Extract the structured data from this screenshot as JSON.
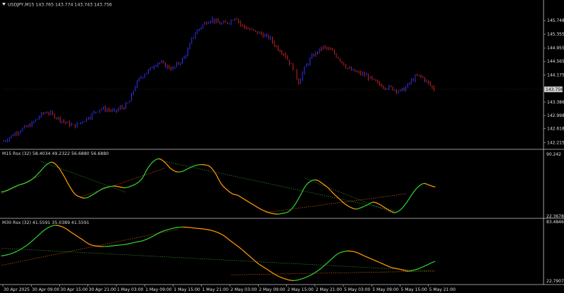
{
  "header": {
    "symbol_line": "USDJPY,M15  143.765 143.774 143.743 143.756",
    "menu_arrow": "triangle-down-icon"
  },
  "colors": {
    "background": "#000000",
    "bull_candle": "#3333ff",
    "bear_candle": "#cc2222",
    "current_price_box": "#d0d0d0",
    "rsi_up": "#33cc33",
    "rsi_down": "#ff9900",
    "trend_green": "#2f8f2f",
    "trend_orange": "#cc5a00",
    "separator": "#c8c8c8"
  },
  "chart_data": [
    {
      "type": "candlestick",
      "name": "USDJPY,M15",
      "ylim": [
        142.1,
        146.1
      ],
      "y_ticks": [
        "145.748",
        "145.355",
        "144.955",
        "144.565",
        "144.175",
        "143.756",
        "143.386",
        "142.998",
        "142.618",
        "142.215"
      ],
      "current_price": 143.756,
      "close_path": [
        142.25,
        142.35,
        142.45,
        142.55,
        142.62,
        142.68,
        142.78,
        142.92,
        143.05,
        143.1,
        143.02,
        142.95,
        142.85,
        142.78,
        142.72,
        142.7,
        142.82,
        142.9,
        143.0,
        143.12,
        143.2,
        143.18,
        143.15,
        143.1,
        143.22,
        143.25,
        143.4,
        143.8,
        144.05,
        144.2,
        144.3,
        144.45,
        144.55,
        144.48,
        144.4,
        144.35,
        144.5,
        144.62,
        144.85,
        145.25,
        145.45,
        145.6,
        145.72,
        145.8,
        145.7,
        145.65,
        145.68,
        145.75,
        145.88,
        145.62,
        145.55,
        145.48,
        145.42,
        145.38,
        145.3,
        145.25,
        145.05,
        144.9,
        144.8,
        144.55,
        144.35,
        143.95,
        144.3,
        144.55,
        144.75,
        144.85,
        144.98,
        144.92,
        144.85,
        144.7,
        144.55,
        144.38,
        144.3,
        144.25,
        144.2,
        144.15,
        144.05,
        143.95,
        143.88,
        143.82,
        143.8,
        143.75,
        143.7,
        143.78,
        143.95,
        144.1,
        144.15,
        144.05,
        143.9,
        143.756
      ]
    },
    {
      "type": "line",
      "name": "RSI M15",
      "label": "M15  Rsx (32) 58.4034 49.2322 56.6880 56.6880",
      "ylim": [
        22.3678,
        90.242
      ],
      "y_ticks": [
        "90.242",
        "22.3678"
      ],
      "values": [
        50,
        52,
        55,
        58,
        60,
        63,
        68,
        75,
        82,
        85,
        80,
        70,
        58,
        48,
        44,
        43,
        46,
        50,
        54,
        56,
        57,
        56,
        55,
        57,
        60,
        66,
        78,
        86,
        89,
        85,
        78,
        74,
        74,
        77,
        80,
        82,
        82,
        80,
        72,
        60,
        53,
        48,
        46,
        42,
        38,
        34,
        30,
        27,
        25,
        24,
        25,
        27,
        34,
        45,
        57,
        63,
        64,
        60,
        55,
        48,
        42,
        36,
        32,
        30,
        32,
        35,
        38,
        36,
        32,
        28,
        26,
        30,
        38,
        48,
        56,
        60,
        58,
        56
      ],
      "trendlines": [
        {
          "color": "green",
          "from": [
            7,
            86
          ],
          "to": [
            22,
            50
          ]
        },
        {
          "color": "orange",
          "from": [
            0,
            48
          ],
          "to": [
            7,
            70
          ]
        },
        {
          "color": "green",
          "from": [
            29,
            86
          ],
          "to": [
            70,
            28
          ]
        },
        {
          "color": "orange",
          "from": [
            14,
            44
          ],
          "to": [
            29,
            78
          ]
        },
        {
          "color": "green",
          "from": [
            54,
            66
          ],
          "to": [
            70,
            24
          ]
        },
        {
          "color": "orange",
          "from": [
            47,
            26
          ],
          "to": [
            72,
            48
          ]
        }
      ]
    },
    {
      "type": "line",
      "name": "RSI M30",
      "label": "M30  Rsx (32) 41.5591 35.0389 41.5591",
      "ylim": [
        22.7907,
        83.4846
      ],
      "y_ticks": [
        "83.4846",
        "22.7907"
      ],
      "values": [
        50,
        52,
        56,
        62,
        70,
        78,
        82,
        80,
        74,
        68,
        62,
        60,
        60,
        61,
        62,
        64,
        66,
        70,
        75,
        78,
        80,
        80,
        79,
        78,
        76,
        72,
        65,
        58,
        50,
        42,
        36,
        30,
        26,
        24,
        26,
        30,
        36,
        44,
        52,
        55,
        54,
        50,
        46,
        42,
        38,
        36,
        34,
        36,
        40,
        44
      ],
      "trendlines": [
        {
          "color": "green",
          "from": [
            0,
            58
          ],
          "to": [
            49,
            34
          ]
        },
        {
          "color": "orange",
          "from": [
            0,
            40
          ],
          "to": [
            20,
            78
          ]
        },
        {
          "color": "orange",
          "from": [
            26,
            30
          ],
          "to": [
            49,
            34
          ]
        }
      ]
    }
  ],
  "time_axis": {
    "labels": [
      "30 Apr 2025",
      "30 Apr 09:00",
      "30 Apr 15:00",
      "30 Apr 21:00",
      "1 May 03:00",
      "1 May 09:00",
      "1 May 15:00",
      "1 May 21:00",
      "2 May 03:00",
      "2 May 09:00",
      "2 May 15:00",
      "2 May 21:00",
      "5 May 03:00",
      "5 May 09:00",
      "5 May 15:00",
      "5 May 21:00"
    ]
  }
}
